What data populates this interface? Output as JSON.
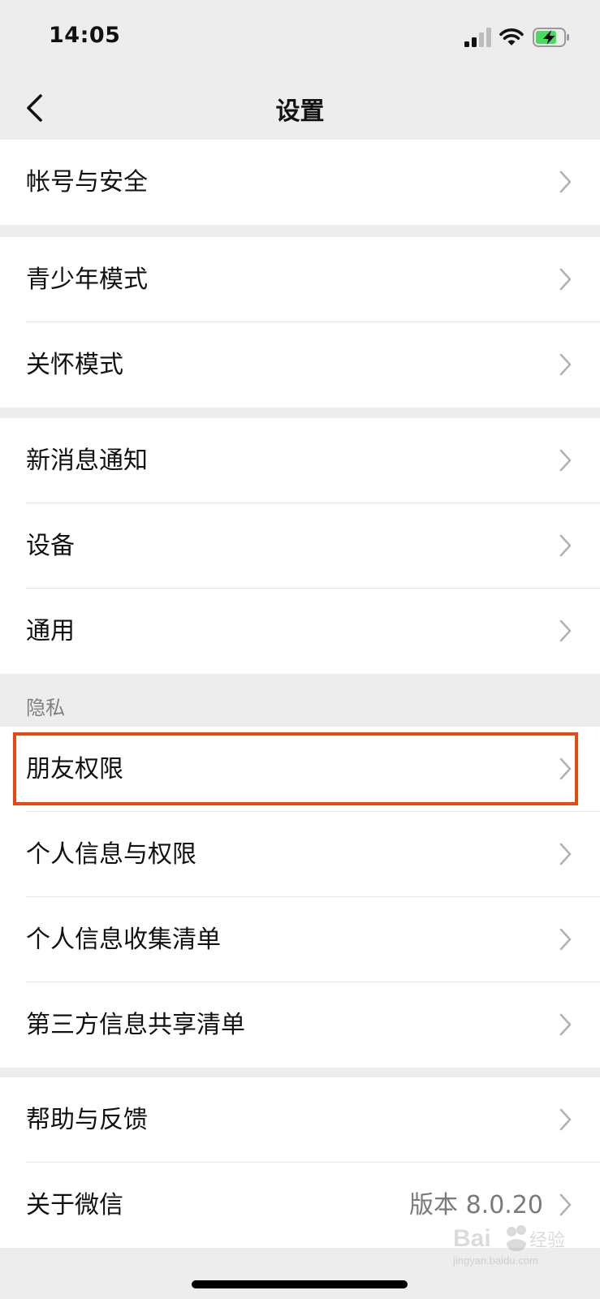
{
  "status_bar": {
    "time": "14:05"
  },
  "nav": {
    "title": "设置"
  },
  "groups": [
    {
      "items": [
        {
          "label": "帐号与安全"
        }
      ]
    },
    {
      "items": [
        {
          "label": "青少年模式"
        },
        {
          "label": "关怀模式"
        }
      ]
    },
    {
      "items": [
        {
          "label": "新消息通知"
        },
        {
          "label": "设备"
        },
        {
          "label": "通用"
        }
      ]
    },
    {
      "header": "隐私",
      "items": [
        {
          "label": "朋友权限"
        },
        {
          "label": "个人信息与权限"
        },
        {
          "label": "个人信息收集清单"
        },
        {
          "label": "第三方信息共享清单"
        }
      ]
    },
    {
      "items": [
        {
          "label": "帮助与反馈"
        },
        {
          "label": "关于微信",
          "value": "版本 8.0.20"
        }
      ]
    }
  ],
  "watermark": {
    "brand": "Bai du 经验",
    "url": "jingyan.baidu.com"
  },
  "colors": {
    "highlight": "#e8490f",
    "background": "#ededed",
    "chevron": "#b2b2b2"
  }
}
